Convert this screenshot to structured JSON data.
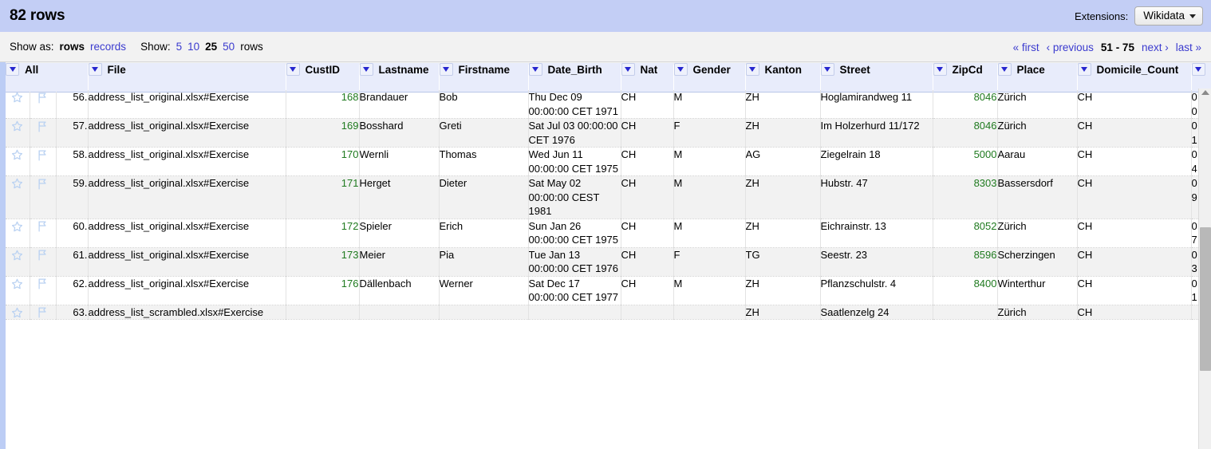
{
  "summary": {
    "row_count_label": "82 rows",
    "extensions_label": "Extensions:",
    "extensions_menu": "Wikidata",
    "caret_icon": "chevron-down-icon"
  },
  "controls": {
    "show_as_label": "Show as:",
    "show_as_options": [
      "rows",
      "records"
    ],
    "show_as_selected": "rows",
    "show_label": "Show:",
    "show_counts": [
      "5",
      "10",
      "25",
      "50"
    ],
    "show_counts_selected": "25",
    "rows_suffix": "rows"
  },
  "paging": {
    "first": "« first",
    "previous": "‹ previous",
    "range": "51 - 75",
    "next": "next ›",
    "last": "last »"
  },
  "columns": [
    {
      "key": "all",
      "label": "All"
    },
    {
      "key": "file",
      "label": "File"
    },
    {
      "key": "custid",
      "label": "CustID"
    },
    {
      "key": "lastname",
      "label": "Lastname"
    },
    {
      "key": "firstname",
      "label": "Firstname"
    },
    {
      "key": "date_birth",
      "label": "Date_Birth"
    },
    {
      "key": "nat",
      "label": "Nat"
    },
    {
      "key": "gender",
      "label": "Gender"
    },
    {
      "key": "kanton",
      "label": "Kanton"
    },
    {
      "key": "street",
      "label": "Street"
    },
    {
      "key": "zipcd",
      "label": "ZipCd"
    },
    {
      "key": "place",
      "label": "Place"
    },
    {
      "key": "domicile_count",
      "label": "Domicile_Count"
    },
    {
      "key": "clipped",
      "label": ""
    }
  ],
  "icons": {
    "row_star": "star-icon",
    "row_flag": "flag-icon",
    "column_menu": "column-dropdown-icon",
    "scroll_up": "scroll-up-arrow-icon"
  },
  "colors": {
    "summary_bg": "#c3cef5",
    "header_bg": "#e8ecfb",
    "link": "#3b3bcf",
    "number": "#1f7a1f",
    "row_alt_bg": "#f2f2f2"
  },
  "rows": [
    {
      "index": "56.",
      "file": "address_list_original.xlsx#Exercise",
      "custid": "168",
      "lastname": "Brandauer",
      "firstname": "Bob",
      "date_birth": "Thu Dec 09 00:00:00 CET 1971",
      "nat": "CH",
      "gender": "M",
      "kanton": "ZH",
      "street": "Hoglamirandweg 11",
      "zipcd": "8046",
      "place": "Zürich",
      "domicile_count": "CH",
      "clipped": "0 0",
      "shade": "odd",
      "clipped_top": true
    },
    {
      "index": "57.",
      "file": "address_list_original.xlsx#Exercise",
      "custid": "169",
      "lastname": "Bosshard",
      "firstname": "Greti",
      "date_birth": "Sat Jul 03 00:00:00 CET 1976",
      "nat": "CH",
      "gender": "F",
      "kanton": "ZH",
      "street": "Im Holzerhurd 11/172",
      "zipcd": "8046",
      "place": "Zürich",
      "domicile_count": "CH",
      "clipped": "0 1",
      "shade": "even"
    },
    {
      "index": "58.",
      "file": "address_list_original.xlsx#Exercise",
      "custid": "170",
      "lastname": "Wernli",
      "firstname": "Thomas",
      "date_birth": "Wed Jun 11 00:00:00 CET 1975",
      "nat": "CH",
      "gender": "M",
      "kanton": "AG",
      "street": "Ziegelrain 18",
      "zipcd": "5000",
      "place": "Aarau",
      "domicile_count": "CH",
      "clipped": "0 4",
      "shade": "odd"
    },
    {
      "index": "59.",
      "file": "address_list_original.xlsx#Exercise",
      "custid": "171",
      "lastname": "Herget",
      "firstname": "Dieter",
      "date_birth": "Sat May 02 00:00:00 CEST 1981",
      "nat": "CH",
      "gender": "M",
      "kanton": "ZH",
      "street": "Hubstr. 47",
      "zipcd": "8303",
      "place": "Bassersdorf",
      "domicile_count": "CH",
      "clipped": "0 9",
      "shade": "even"
    },
    {
      "index": "60.",
      "file": "address_list_original.xlsx#Exercise",
      "custid": "172",
      "lastname": "Spieler",
      "firstname": "Erich",
      "date_birth": "Sun Jan 26 00:00:00 CET 1975",
      "nat": "CH",
      "gender": "M",
      "kanton": "ZH",
      "street": "Eichrainstr. 13",
      "zipcd": "8052",
      "place": "Zürich",
      "domicile_count": "CH",
      "clipped": "0 7",
      "shade": "odd"
    },
    {
      "index": "61.",
      "file": "address_list_original.xlsx#Exercise",
      "custid": "173",
      "lastname": "Meier",
      "firstname": "Pia",
      "date_birth": "Tue Jan 13 00:00:00 CET 1976",
      "nat": "CH",
      "gender": "F",
      "kanton": "TG",
      "street": "Seestr. 23",
      "zipcd": "8596",
      "place": "Scherzingen",
      "domicile_count": "CH",
      "clipped": "0 3",
      "shade": "even"
    },
    {
      "index": "62.",
      "file": "address_list_original.xlsx#Exercise",
      "custid": "176",
      "lastname": "Dällenbach",
      "firstname": "Werner",
      "date_birth": "Sat Dec 17 00:00:00 CET 1977",
      "nat": "CH",
      "gender": "M",
      "kanton": "ZH",
      "street": "Pflanzschulstr. 4",
      "zipcd": "8400",
      "place": "Winterthur",
      "domicile_count": "CH",
      "clipped": "0 1",
      "shade": "odd"
    },
    {
      "index": "63.",
      "file": "address_list_scrambled.xlsx#Exercise",
      "custid": "",
      "lastname": "",
      "firstname": "",
      "date_birth": "",
      "nat": "",
      "gender": "",
      "kanton": "ZH",
      "street": "Saatlenzelg 24",
      "zipcd": "",
      "place": "Zürich",
      "domicile_count": "CH",
      "clipped": "",
      "shade": "even"
    }
  ]
}
